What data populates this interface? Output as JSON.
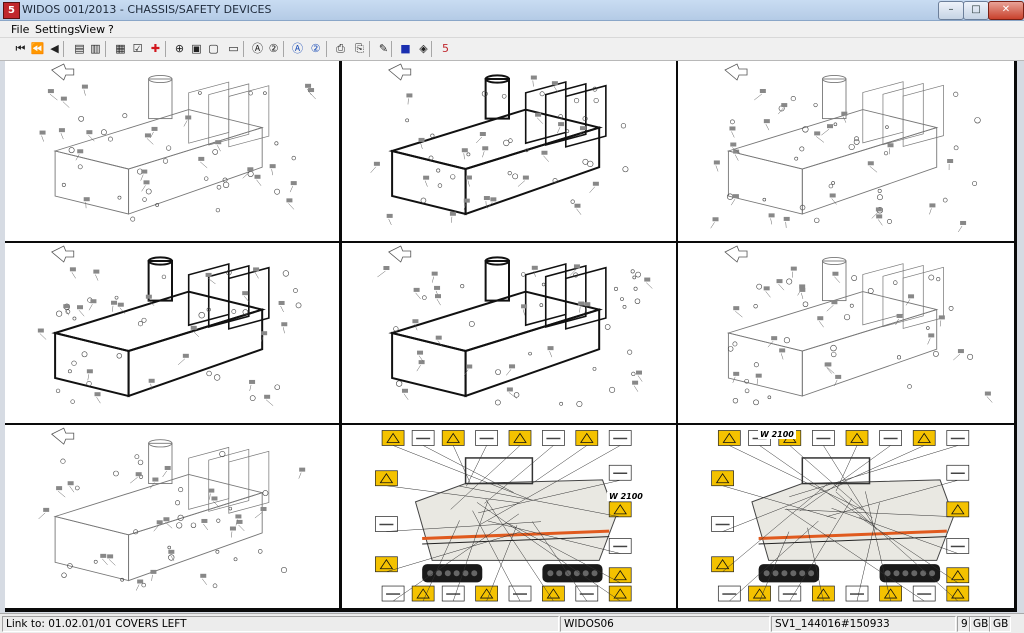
{
  "window": {
    "title": "WIDOS 001/2013 - CHASSIS/SAFETY DEVICES",
    "app_icon": "5",
    "minimize": "–",
    "maximize": "□",
    "close": "✕"
  },
  "menu": [
    {
      "label": "File"
    },
    {
      "label": "Settings"
    },
    {
      "label": "View"
    },
    {
      "label": "?"
    }
  ],
  "toolbar": {
    "icons": [
      {
        "name": "first-page-icon",
        "glyph": "⏮"
      },
      {
        "name": "previous-page-icon",
        "glyph": "⏪"
      },
      {
        "name": "back-icon",
        "glyph": "◀"
      },
      {
        "name": "page-up-icon",
        "glyph": "▤"
      },
      {
        "name": "page-forward-icon",
        "glyph": "▥"
      },
      {
        "name": "print-list-icon",
        "glyph": "▦"
      },
      {
        "name": "checklist-icon",
        "glyph": "☑"
      },
      {
        "name": "add-red-cross-icon",
        "glyph": "✚",
        "color": "#d2161c"
      },
      {
        "name": "zoom-in-icon",
        "glyph": "⊕"
      },
      {
        "name": "page-view-icon",
        "glyph": "▣"
      },
      {
        "name": "two-page-view-icon",
        "glyph": "▢"
      },
      {
        "name": "fullscreen-icon",
        "glyph": "▭"
      },
      {
        "name": "search-a-icon",
        "glyph": "Ⓐ"
      },
      {
        "name": "search-2-icon",
        "glyph": "②"
      },
      {
        "name": "circle-a-blue-icon",
        "glyph": "Ⓐ",
        "color": "#1d4fb8"
      },
      {
        "name": "circle-2-blue-icon",
        "glyph": "②",
        "color": "#1d4fb8"
      },
      {
        "name": "printer-icon",
        "glyph": "⎙"
      },
      {
        "name": "printer-setup-icon",
        "glyph": "⎘"
      },
      {
        "name": "notes-icon",
        "glyph": "✎"
      },
      {
        "name": "blue-square-icon",
        "glyph": "■",
        "color": "#1a2fb0"
      },
      {
        "name": "eraser-icon",
        "glyph": "◈"
      },
      {
        "name": "widos-logo-icon",
        "glyph": "5",
        "color": "#c0272d"
      }
    ]
  },
  "thumbnails": [
    {
      "name": "thumb-chassis-exploded-1"
    },
    {
      "name": "thumb-chassis-frame-black"
    },
    {
      "name": "thumb-chassis-frame-gray"
    },
    {
      "name": "thumb-chassis-covers-left"
    },
    {
      "name": "thumb-chassis-covers-left-2"
    },
    {
      "name": "thumb-chassis-covers-right"
    },
    {
      "name": "thumb-chassis-underside"
    },
    {
      "name": "thumb-safety-decals-left",
      "model": "W 2100"
    },
    {
      "name": "thumb-safety-decals-right",
      "model": "W 2100"
    }
  ],
  "status": {
    "link": "Link to: 01.02.01/01 COVERS LEFT",
    "doc": "WIDOS06",
    "id": "SV1_144016#150933",
    "page": "9",
    "lang1": "GB",
    "lang2": "GB"
  },
  "colors": {
    "decal_yellow": "#f4c200",
    "machine_white": "#e9e8e2",
    "track_black": "#1a1a1a",
    "stripe_orange": "#e05a1e"
  }
}
